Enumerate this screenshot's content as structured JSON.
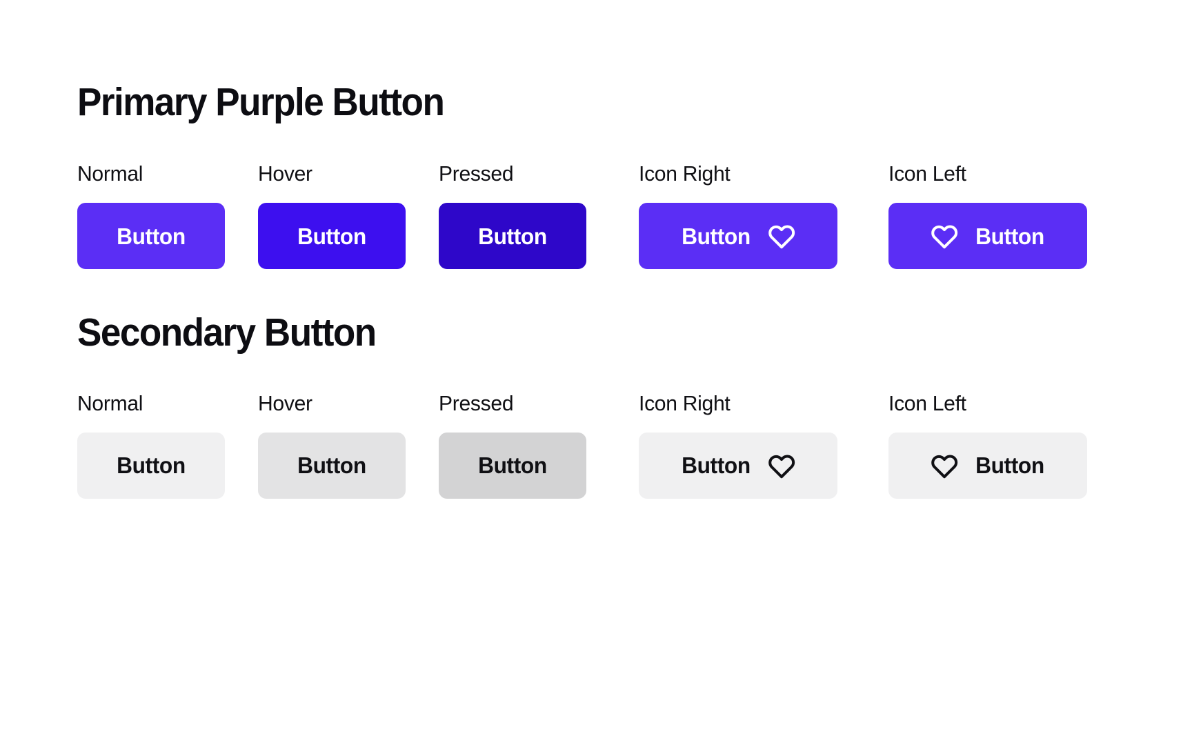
{
  "page": {
    "background": "#ffffff",
    "text_color": "#101014"
  },
  "sections": [
    {
      "id": "primary-purple-button",
      "title": "Primary Purple Button",
      "variant": "primary",
      "states": [
        {
          "label": "Normal",
          "button_text": "Button",
          "background": "#5B2EF5",
          "text_color": "#ffffff",
          "icon": null,
          "icon_position": "none"
        },
        {
          "label": "Hover",
          "button_text": "Button",
          "background": "#3D0FEF",
          "text_color": "#ffffff",
          "icon": null,
          "icon_position": "none"
        },
        {
          "label": "Pressed",
          "button_text": "Button",
          "background": "#2E07C9",
          "text_color": "#ffffff",
          "icon": null,
          "icon_position": "none"
        },
        {
          "label": "Icon Right",
          "button_text": "Button",
          "background": "#5B2EF5",
          "text_color": "#ffffff",
          "icon": "heart-icon",
          "icon_position": "right"
        },
        {
          "label": "Icon Left",
          "button_text": "Button",
          "background": "#5B2EF5",
          "text_color": "#ffffff",
          "icon": "heart-icon",
          "icon_position": "left"
        }
      ]
    },
    {
      "id": "secondary-button",
      "title": "Secondary Button",
      "variant": "secondary",
      "states": [
        {
          "label": "Normal",
          "button_text": "Button",
          "background": "#F0F0F1",
          "text_color": "#101014",
          "icon": null,
          "icon_position": "none"
        },
        {
          "label": "Hover",
          "button_text": "Button",
          "background": "#E3E3E4",
          "text_color": "#101014",
          "icon": null,
          "icon_position": "none"
        },
        {
          "label": "Pressed",
          "button_text": "Button",
          "background": "#D3D3D4",
          "text_color": "#101014",
          "icon": null,
          "icon_position": "none"
        },
        {
          "label": "Icon Right",
          "button_text": "Button",
          "background": "#F0F0F1",
          "text_color": "#101014",
          "icon": "heart-icon",
          "icon_position": "right"
        },
        {
          "label": "Icon Left",
          "button_text": "Button",
          "background": "#F0F0F1",
          "text_color": "#101014",
          "icon": "heart-icon",
          "icon_position": "left"
        }
      ]
    }
  ]
}
